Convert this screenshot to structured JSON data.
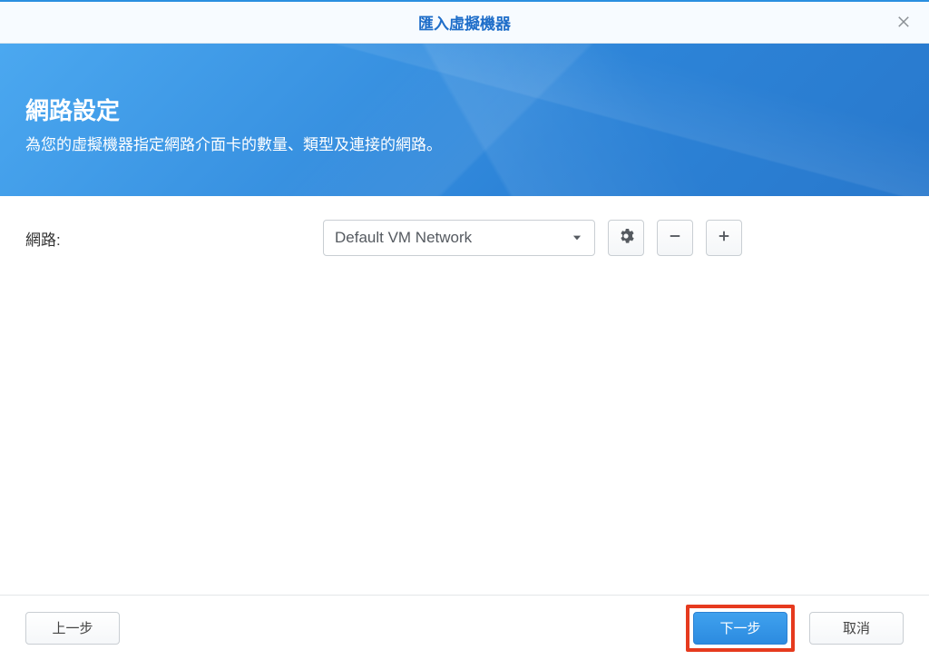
{
  "dialog": {
    "title": "匯入虛擬機器"
  },
  "banner": {
    "title": "網路設定",
    "subtitle": "為您的虛擬機器指定網路介面卡的數量、類型及連接的網路。"
  },
  "form": {
    "network_label": "網路:",
    "network_select": {
      "selected": "Default VM Network"
    }
  },
  "footer": {
    "back": "上一步",
    "next": "下一步",
    "cancel": "取消"
  }
}
